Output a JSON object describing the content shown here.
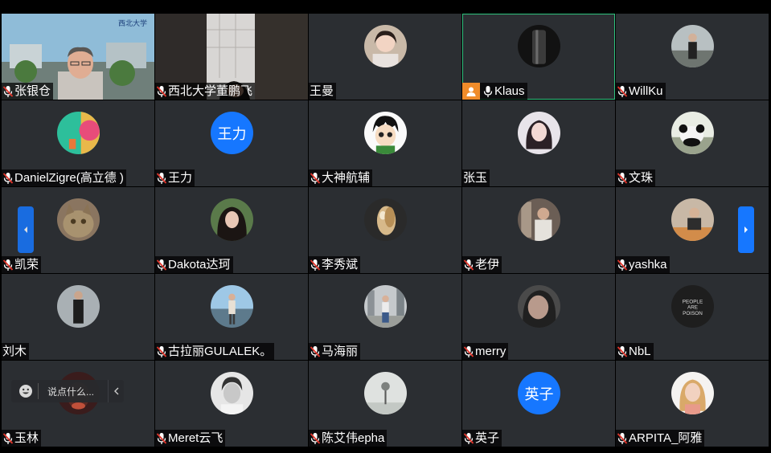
{
  "participants": [
    {
      "name": "张银仓",
      "muted": true,
      "type": "video-campus"
    },
    {
      "name": "西北大学董鹏飞",
      "muted": true,
      "type": "video-room"
    },
    {
      "name": "王曼",
      "muted": false,
      "type": "avatar",
      "avatar": "girl-portrait"
    },
    {
      "name": "Klaus",
      "muted": false,
      "host": true,
      "active": true,
      "type": "avatar",
      "avatar": "dark-object"
    },
    {
      "name": "WillKu",
      "muted": true,
      "type": "avatar",
      "avatar": "person-outdoor"
    },
    {
      "name": "DanielZigre(高立德 )",
      "muted": true,
      "type": "avatar",
      "avatar": "colorful-abstract"
    },
    {
      "name": "王力",
      "muted": true,
      "type": "text-avatar",
      "initials": "王力"
    },
    {
      "name": "大神航辅",
      "muted": true,
      "type": "avatar",
      "avatar": "cartoon-boy"
    },
    {
      "name": "张玉",
      "muted": false,
      "type": "avatar",
      "avatar": "woman-portrait"
    },
    {
      "name": "文珠",
      "muted": true,
      "type": "avatar",
      "avatar": "panda"
    },
    {
      "name": "凯荣",
      "muted": true,
      "type": "avatar",
      "avatar": "cat"
    },
    {
      "name": "Dakota达珂",
      "muted": true,
      "type": "avatar",
      "avatar": "woman-dark-hair"
    },
    {
      "name": "李秀斌",
      "muted": true,
      "type": "avatar",
      "avatar": "owl"
    },
    {
      "name": "老伊",
      "muted": true,
      "type": "avatar",
      "avatar": "person-cafe"
    },
    {
      "name": "yashka",
      "muted": true,
      "type": "avatar",
      "avatar": "man-seated"
    },
    {
      "name": "刘木",
      "muted": false,
      "type": "avatar",
      "avatar": "man-standing"
    },
    {
      "name": "古拉丽GULALEK。",
      "muted": true,
      "type": "avatar",
      "avatar": "woman-waterfront"
    },
    {
      "name": "马海丽",
      "muted": true,
      "type": "avatar",
      "avatar": "woman-city"
    },
    {
      "name": "merry",
      "muted": true,
      "type": "avatar",
      "avatar": "woman-closeup"
    },
    {
      "name": "NbL",
      "muted": true,
      "type": "avatar",
      "avatar": "people-are-poison"
    },
    {
      "name": "玉林",
      "muted": true,
      "type": "avatar",
      "avatar": "dark-red-portrait"
    },
    {
      "name": "Meret云飞",
      "muted": true,
      "type": "avatar",
      "avatar": "man-bw"
    },
    {
      "name": "陈艾伟epha",
      "muted": true,
      "type": "avatar",
      "avatar": "foggy-tree"
    },
    {
      "name": "英子",
      "muted": true,
      "type": "text-avatar",
      "initials": "英子"
    },
    {
      "name": "ARPITA_阿雅",
      "muted": true,
      "type": "avatar",
      "avatar": "woman-blonde"
    }
  ],
  "chat": {
    "placeholder": "说点什么..."
  },
  "icons": {
    "muted_mic": "muted-mic-icon",
    "mic": "mic-icon",
    "host": "host-person-icon",
    "prev_page": "chevron-left-icon",
    "next_page": "chevron-right-icon",
    "emoji": "smile-icon",
    "collapse": "chevron-left-icon"
  },
  "colors": {
    "tile_bg": "#2b2e32",
    "accent": "#1677ff",
    "active_border": "#2ec27e",
    "host_badge": "#f08c2a",
    "muted_red": "#e0352b"
  }
}
